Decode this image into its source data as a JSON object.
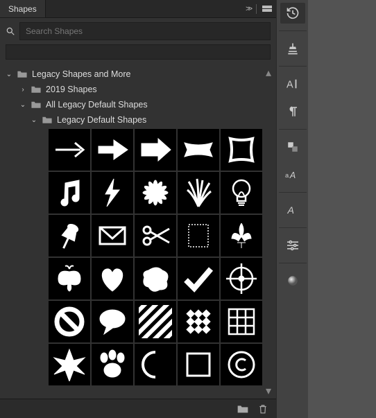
{
  "panel": {
    "tab_label": "Shapes",
    "search_placeholder": "Search Shapes",
    "tree": {
      "root_label": "Legacy Shapes and More",
      "child1_label": "2019 Shapes",
      "child2_label": "All Legacy Default Shapes",
      "grandchild_label": "Legacy Default Shapes"
    }
  },
  "shapes": [
    {
      "name": "arrow-thin",
      "row": 1
    },
    {
      "name": "arrow-medium",
      "row": 1
    },
    {
      "name": "arrow-block",
      "row": 1
    },
    {
      "name": "banner-curled",
      "row": 1
    },
    {
      "name": "frame-wavy",
      "row": 1
    },
    {
      "name": "music-notes",
      "row": 2
    },
    {
      "name": "lightning-bolt",
      "row": 2
    },
    {
      "name": "flower-burst",
      "row": 2
    },
    {
      "name": "grass-tuft",
      "row": 2
    },
    {
      "name": "light-bulb",
      "row": 2
    },
    {
      "name": "push-pin",
      "row": 3
    },
    {
      "name": "envelope",
      "row": 3
    },
    {
      "name": "scissors",
      "row": 3
    },
    {
      "name": "postage-stamp",
      "row": 3
    },
    {
      "name": "fleur-de-lis",
      "row": 3
    },
    {
      "name": "butterfly",
      "row": 4
    },
    {
      "name": "heart",
      "row": 4
    },
    {
      "name": "blob",
      "row": 4
    },
    {
      "name": "checkmark",
      "row": 4
    },
    {
      "name": "crosshair-target",
      "row": 4
    },
    {
      "name": "no-sign",
      "row": 5
    },
    {
      "name": "speech-bubble",
      "row": 5
    },
    {
      "name": "diagonal-stripes",
      "row": 5
    },
    {
      "name": "checkerboard",
      "row": 5
    },
    {
      "name": "grid-3x3",
      "row": 5
    },
    {
      "name": "starburst",
      "row": 6
    },
    {
      "name": "paw-print",
      "row": 6
    },
    {
      "name": "crescent",
      "row": 6
    },
    {
      "name": "square-outline",
      "row": 6
    },
    {
      "name": "copyright",
      "row": 6
    }
  ],
  "toolbar_items": [
    {
      "name": "history-icon"
    },
    {
      "name": "clone-stamp-icon"
    },
    {
      "name": "character-icon"
    },
    {
      "name": "paragraph-icon"
    },
    {
      "name": "layers-align-icon"
    },
    {
      "name": "glyphs-icon"
    },
    {
      "name": "type-styles-icon"
    },
    {
      "name": "adjustments-icon"
    },
    {
      "name": "sphere-3d-icon"
    }
  ]
}
